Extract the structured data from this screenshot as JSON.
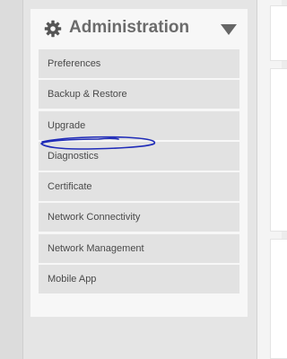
{
  "panel": {
    "title": "Administration",
    "header_icon": "gear-icon",
    "toggle_icon": "caret-down-icon"
  },
  "menu": {
    "items": [
      {
        "label": "Preferences"
      },
      {
        "label": "Backup & Restore"
      },
      {
        "label": "Upgrade"
      },
      {
        "label": "Diagnostics"
      },
      {
        "label": "Certificate"
      },
      {
        "label": "Network Connectivity"
      },
      {
        "label": "Network Management"
      },
      {
        "label": "Mobile App"
      }
    ]
  },
  "colors": {
    "title_text": "#6b6b6b",
    "item_bg": "#e2e2e2",
    "item_text": "#4a4a4a",
    "annotation_ink": "#1f2bb8"
  }
}
